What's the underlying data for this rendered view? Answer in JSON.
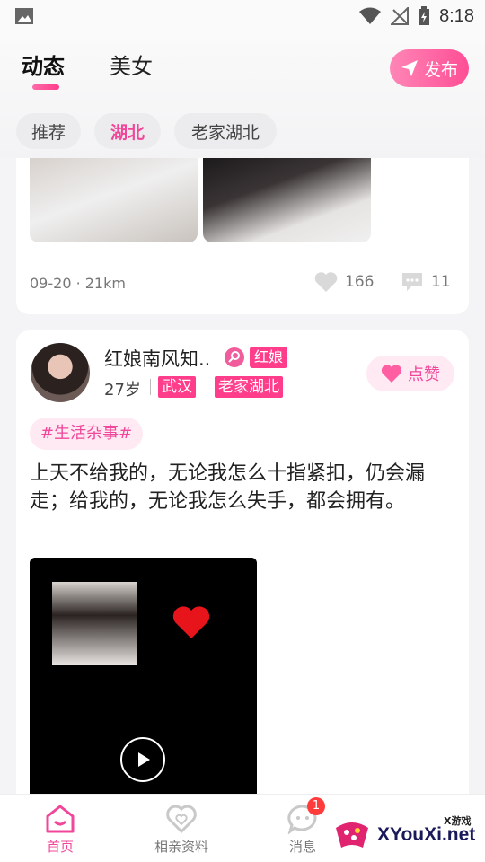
{
  "status_bar": {
    "time": "8:18"
  },
  "header": {
    "tabs": [
      {
        "label": "动态"
      },
      {
        "label": "美女"
      }
    ],
    "publish_label": "发布"
  },
  "filters": [
    {
      "label": "推荐"
    },
    {
      "label": "湖北"
    },
    {
      "label": "老家湖北"
    }
  ],
  "posts": [
    {
      "meta": "09-20 · 21km",
      "likes": "166",
      "comments": "11"
    },
    {
      "name": "红娘南风知..",
      "role_badge": "红娘",
      "age": "27岁",
      "city": "武汉",
      "hometown": "老家湖北",
      "like_label": "点赞",
      "topic": "#生活杂事#",
      "text": "上天不给我的，无论我怎么十指紧扣，仍会漏走；给我的，无论我怎么失手，都会拥有。"
    }
  ],
  "bottom_nav": {
    "items": [
      {
        "label": "首页"
      },
      {
        "label": "相亲资料"
      },
      {
        "label": "消息"
      }
    ],
    "message_badge": "1"
  },
  "watermark": {
    "small": "X游戏",
    "big": "XYouXi.net"
  },
  "colors": {
    "accent": "#f0479a",
    "badge": "#ff3d8b"
  }
}
